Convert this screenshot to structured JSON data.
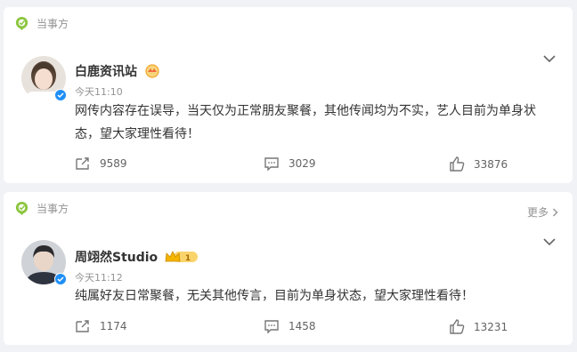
{
  "posts": [
    {
      "tag": "当事方",
      "author": "白鹿资讯站",
      "time": "今天11:10",
      "content_lines": [
        "网传内容存在误导，当天仅为正常朋友聚餐，其他传闻均为不实，艺人目前为单身状",
        "态，望大家理性看待！"
      ],
      "reposts": "9589",
      "comments": "3029",
      "likes": "33876"
    },
    {
      "tag": "当事方",
      "more": "更多",
      "author": "周翊然Studio",
      "level": "1",
      "time": "今天11:12",
      "content_lines": [
        "纯属好友日常聚餐，无关其他传言，目前为单身状态，望大家理性看待！"
      ],
      "reposts": "1174",
      "comments": "1458",
      "likes": "13231"
    }
  ],
  "colors": {
    "accent_green": "#8cc63f",
    "verified_blue": "#1f8ff5",
    "muted": "#939393",
    "gold": "#f4b400"
  },
  "icons": [
    "location-pin-icon",
    "chevron-down-icon",
    "repost-icon",
    "comment-icon",
    "like-icon",
    "verified-icon",
    "crown-badge-icon"
  ]
}
